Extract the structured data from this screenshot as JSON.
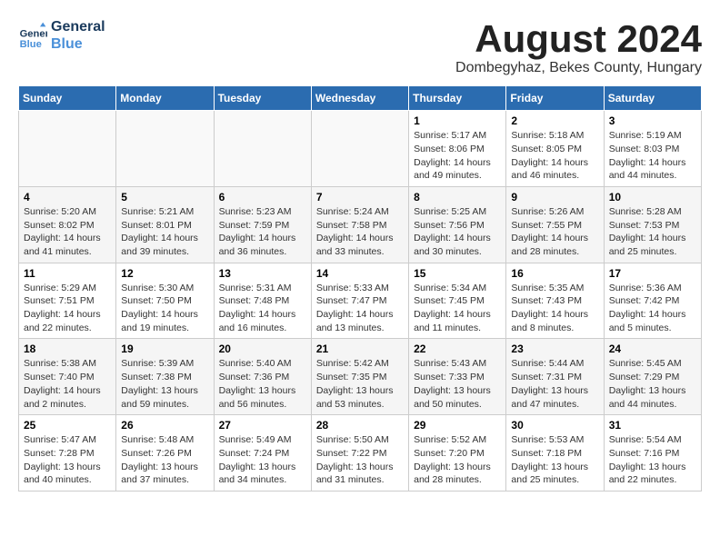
{
  "header": {
    "logo_line1": "General",
    "logo_line2": "Blue",
    "month_year": "August 2024",
    "location": "Dombegyhaz, Bekes County, Hungary"
  },
  "weekdays": [
    "Sunday",
    "Monday",
    "Tuesday",
    "Wednesday",
    "Thursday",
    "Friday",
    "Saturday"
  ],
  "weeks": [
    [
      {
        "day": "",
        "info": ""
      },
      {
        "day": "",
        "info": ""
      },
      {
        "day": "",
        "info": ""
      },
      {
        "day": "",
        "info": ""
      },
      {
        "day": "1",
        "info": "Sunrise: 5:17 AM\nSunset: 8:06 PM\nDaylight: 14 hours\nand 49 minutes."
      },
      {
        "day": "2",
        "info": "Sunrise: 5:18 AM\nSunset: 8:05 PM\nDaylight: 14 hours\nand 46 minutes."
      },
      {
        "day": "3",
        "info": "Sunrise: 5:19 AM\nSunset: 8:03 PM\nDaylight: 14 hours\nand 44 minutes."
      }
    ],
    [
      {
        "day": "4",
        "info": "Sunrise: 5:20 AM\nSunset: 8:02 PM\nDaylight: 14 hours\nand 41 minutes."
      },
      {
        "day": "5",
        "info": "Sunrise: 5:21 AM\nSunset: 8:01 PM\nDaylight: 14 hours\nand 39 minutes."
      },
      {
        "day": "6",
        "info": "Sunrise: 5:23 AM\nSunset: 7:59 PM\nDaylight: 14 hours\nand 36 minutes."
      },
      {
        "day": "7",
        "info": "Sunrise: 5:24 AM\nSunset: 7:58 PM\nDaylight: 14 hours\nand 33 minutes."
      },
      {
        "day": "8",
        "info": "Sunrise: 5:25 AM\nSunset: 7:56 PM\nDaylight: 14 hours\nand 30 minutes."
      },
      {
        "day": "9",
        "info": "Sunrise: 5:26 AM\nSunset: 7:55 PM\nDaylight: 14 hours\nand 28 minutes."
      },
      {
        "day": "10",
        "info": "Sunrise: 5:28 AM\nSunset: 7:53 PM\nDaylight: 14 hours\nand 25 minutes."
      }
    ],
    [
      {
        "day": "11",
        "info": "Sunrise: 5:29 AM\nSunset: 7:51 PM\nDaylight: 14 hours\nand 22 minutes."
      },
      {
        "day": "12",
        "info": "Sunrise: 5:30 AM\nSunset: 7:50 PM\nDaylight: 14 hours\nand 19 minutes."
      },
      {
        "day": "13",
        "info": "Sunrise: 5:31 AM\nSunset: 7:48 PM\nDaylight: 14 hours\nand 16 minutes."
      },
      {
        "day": "14",
        "info": "Sunrise: 5:33 AM\nSunset: 7:47 PM\nDaylight: 14 hours\nand 13 minutes."
      },
      {
        "day": "15",
        "info": "Sunrise: 5:34 AM\nSunset: 7:45 PM\nDaylight: 14 hours\nand 11 minutes."
      },
      {
        "day": "16",
        "info": "Sunrise: 5:35 AM\nSunset: 7:43 PM\nDaylight: 14 hours\nand 8 minutes."
      },
      {
        "day": "17",
        "info": "Sunrise: 5:36 AM\nSunset: 7:42 PM\nDaylight: 14 hours\nand 5 minutes."
      }
    ],
    [
      {
        "day": "18",
        "info": "Sunrise: 5:38 AM\nSunset: 7:40 PM\nDaylight: 14 hours\nand 2 minutes."
      },
      {
        "day": "19",
        "info": "Sunrise: 5:39 AM\nSunset: 7:38 PM\nDaylight: 13 hours\nand 59 minutes."
      },
      {
        "day": "20",
        "info": "Sunrise: 5:40 AM\nSunset: 7:36 PM\nDaylight: 13 hours\nand 56 minutes."
      },
      {
        "day": "21",
        "info": "Sunrise: 5:42 AM\nSunset: 7:35 PM\nDaylight: 13 hours\nand 53 minutes."
      },
      {
        "day": "22",
        "info": "Sunrise: 5:43 AM\nSunset: 7:33 PM\nDaylight: 13 hours\nand 50 minutes."
      },
      {
        "day": "23",
        "info": "Sunrise: 5:44 AM\nSunset: 7:31 PM\nDaylight: 13 hours\nand 47 minutes."
      },
      {
        "day": "24",
        "info": "Sunrise: 5:45 AM\nSunset: 7:29 PM\nDaylight: 13 hours\nand 44 minutes."
      }
    ],
    [
      {
        "day": "25",
        "info": "Sunrise: 5:47 AM\nSunset: 7:28 PM\nDaylight: 13 hours\nand 40 minutes."
      },
      {
        "day": "26",
        "info": "Sunrise: 5:48 AM\nSunset: 7:26 PM\nDaylight: 13 hours\nand 37 minutes."
      },
      {
        "day": "27",
        "info": "Sunrise: 5:49 AM\nSunset: 7:24 PM\nDaylight: 13 hours\nand 34 minutes."
      },
      {
        "day": "28",
        "info": "Sunrise: 5:50 AM\nSunset: 7:22 PM\nDaylight: 13 hours\nand 31 minutes."
      },
      {
        "day": "29",
        "info": "Sunrise: 5:52 AM\nSunset: 7:20 PM\nDaylight: 13 hours\nand 28 minutes."
      },
      {
        "day": "30",
        "info": "Sunrise: 5:53 AM\nSunset: 7:18 PM\nDaylight: 13 hours\nand 25 minutes."
      },
      {
        "day": "31",
        "info": "Sunrise: 5:54 AM\nSunset: 7:16 PM\nDaylight: 13 hours\nand 22 minutes."
      }
    ]
  ]
}
